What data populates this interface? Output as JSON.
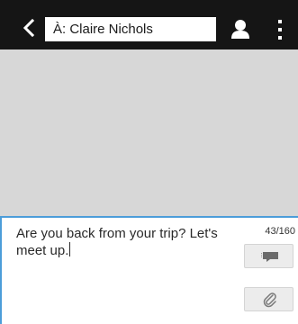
{
  "header": {
    "recipient_text": "À: Claire Nichols",
    "icons": {
      "back": "chevron-left-icon",
      "contact": "person-icon",
      "menu": "more-vertical-icon"
    }
  },
  "compose": {
    "message_text": "Are you back from your trip? Let's meet up.",
    "char_counter": "43/160",
    "icons": {
      "send": "send-icon",
      "attach": "paperclip-icon"
    }
  },
  "colors": {
    "topbar": "#151515",
    "thread_background": "#d7d7d7",
    "accent": "#4c9dd9",
    "button_background": "#ececec"
  }
}
